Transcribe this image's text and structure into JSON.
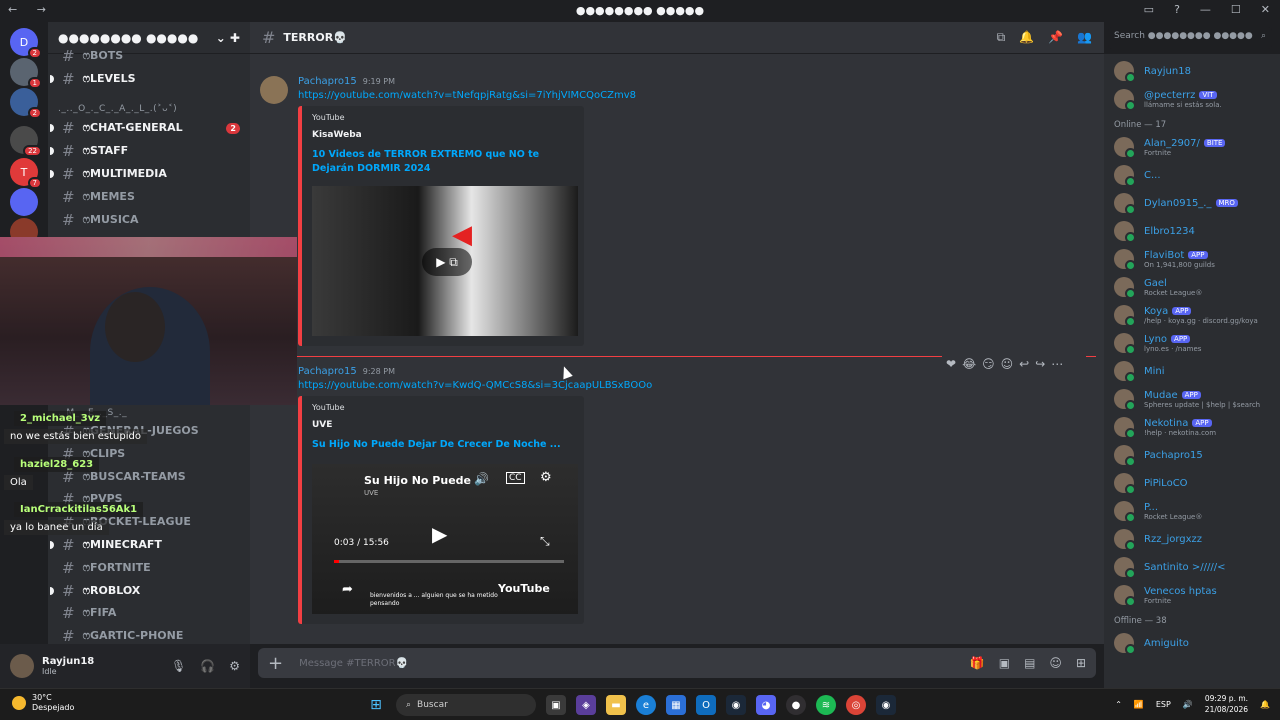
{
  "titlebar": {
    "title": "●●●●●●●● ●●●●●",
    "nav": "← →"
  },
  "servers": [
    {
      "label": "D",
      "badge": "2",
      "color": "#5865f2"
    },
    {
      "label": "",
      "badge": "1",
      "color": "#5a6470"
    },
    {
      "label": "",
      "badge": "2",
      "color": "#3a5f9a"
    },
    {
      "label": "",
      "badge": "22",
      "color": "#4a4a4a"
    },
    {
      "label": "T",
      "badge": "7",
      "color": "#e03a3a"
    },
    {
      "label": "",
      "badge": "",
      "color": "#5865f2"
    },
    {
      "label": "",
      "badge": "",
      "color": "#8a3a2a"
    }
  ],
  "guild": {
    "name": "●●●●●●●● ●●●●●"
  },
  "channels": {
    "top": [
      {
        "name": "ෆBOTS",
        "unread": false,
        "badge": ""
      },
      {
        "name": "ෆLEVELS",
        "unread": true,
        "badge": ""
      }
    ],
    "category1": "._.._O_._C_._A_._L_.(˃ᴗ˂)",
    "list": [
      {
        "name": "ෆCHAT-GENERAL",
        "unread": true,
        "badge": "2"
      },
      {
        "name": "ෆSTAFF",
        "unread": true,
        "badge": ""
      },
      {
        "name": "ෆMULTIMEDIA",
        "unread": true,
        "badge": ""
      },
      {
        "name": "ෆMEMES",
        "unread": false,
        "badge": ""
      },
      {
        "name": "ෆMUSICA",
        "unread": false,
        "badge": ""
      }
    ],
    "category2": "._M_._E_._S_._",
    "list2": [
      {
        "name": "ෆGENERAL-JUEGOS",
        "unread": false,
        "badge": ""
      },
      {
        "name": "ෆCLIPS",
        "unread": false,
        "badge": ""
      },
      {
        "name": "ෆBUSCAR-TEAMS",
        "unread": false,
        "badge": ""
      },
      {
        "name": "ෆPVPS",
        "unread": false,
        "badge": ""
      },
      {
        "name": "ෆROCKET-LEAGUE",
        "unread": false,
        "badge": ""
      },
      {
        "name": "ෆMINECRAFT",
        "unread": true,
        "badge": ""
      },
      {
        "name": "ෆFORTNITE",
        "unread": false,
        "badge": ""
      },
      {
        "name": "ෆROBLOX",
        "unread": true,
        "badge": ""
      },
      {
        "name": "ෆFIFA",
        "unread": false,
        "badge": ""
      },
      {
        "name": "ෆGARTIC-PHONE",
        "unread": false,
        "badge": ""
      }
    ]
  },
  "user": {
    "name": "Rayjun18",
    "status": "Idle"
  },
  "chat": {
    "channel": "TERROR💀",
    "search_placeholder": "Search ●●●●●●●● ●●●●●",
    "composer_placeholder": "Message #TERROR💀",
    "messages": [
      {
        "author": "Pachapro15",
        "time": "9:19 PM",
        "link": "https://youtube.com/watch?v=tNefqpjRatg&si=7iYhjVIMCQoCZmv8",
        "embed": {
          "provider": "YouTube",
          "author": "KisaWeba",
          "title": "10 Videos de TERROR EXTREMO que NO te Dejarán DORMIR 2024"
        }
      },
      {
        "author": "Pachapro15",
        "time": "9:28 PM",
        "link": "https://youtube.com/watch?v=KwdQ-QMCcS8&si=3CjcaapULBSxBOOo",
        "embed": {
          "provider": "YouTube",
          "author": "UVE",
          "title": "Su Hijo No Puede Dejar De Crecer De Noche ...",
          "player_title": "Su Hijo No Puede",
          "player_channel": "UVE",
          "time": "0:03 / 15:56",
          "caption": "bienvenidos a ... alguien que se ha metido pensando",
          "logo": "YouTube"
        }
      }
    ]
  },
  "members": {
    "top": [
      {
        "name": "Rayjun18",
        "sub": "",
        "tag": "",
        "color": "#3ba0e6"
      },
      {
        "name": "@pecterrz",
        "sub": "llámame si estás sola.",
        "tag": "VIT",
        "color": "#3ba0e6"
      }
    ],
    "online_label": "Online — 17",
    "online": [
      {
        "name": "Alan_2907/",
        "sub": "Fortnite",
        "tag": "BITE"
      },
      {
        "name": "C...",
        "sub": "",
        "tag": ""
      },
      {
        "name": "Dylan0915_._",
        "sub": "",
        "tag": "MRO"
      },
      {
        "name": "Elbro1234",
        "sub": "",
        "tag": ""
      },
      {
        "name": "FlaviBot",
        "sub": "On 1,941,800 guilds",
        "tag": "APP"
      },
      {
        "name": "Gael",
        "sub": "Rocket League®",
        "tag": ""
      },
      {
        "name": "Koya",
        "sub": "/help · koya.gg · discord.gg/koya",
        "tag": "APP"
      },
      {
        "name": "Lyno",
        "sub": "lyno.es · /names",
        "tag": "APP"
      },
      {
        "name": "Mini",
        "sub": "",
        "tag": ""
      },
      {
        "name": "Mudae",
        "sub": "Spheres update | $help | $search",
        "tag": "APP"
      },
      {
        "name": "Nekotina",
        "sub": "!help · nekotina.com",
        "tag": "APP"
      },
      {
        "name": "Pachapro15",
        "sub": "",
        "tag": ""
      },
      {
        "name": "PiPiLoCO",
        "sub": "",
        "tag": ""
      },
      {
        "name": "P...",
        "sub": "Rocket League®",
        "tag": ""
      },
      {
        "name": "Rzz_jorgxzz",
        "sub": "",
        "tag": ""
      },
      {
        "name": "Santinito >/////<",
        "sub": "",
        "tag": ""
      },
      {
        "name": "Venecos hptas",
        "sub": "Fortnite",
        "tag": ""
      }
    ],
    "offline_label": "Offline — 38",
    "offline": [
      {
        "name": "Amiguito",
        "sub": "",
        "tag": ""
      }
    ]
  },
  "overlay": {
    "chat": [
      {
        "name": "2_michael_3vz",
        "text": "no we estás bien estupido"
      },
      {
        "name": "haziel28_623",
        "text": "Ola"
      },
      {
        "name": "IanCrrackitilas56Ak1",
        "text": "ya lo banee un día"
      }
    ]
  },
  "taskbar": {
    "temp": "30°C",
    "weather": "Despejado",
    "search": "Buscar",
    "lang": "ESP",
    "time": "09:29 p. m.",
    "date": "21/08/2026"
  },
  "colors": {
    "accent": "#5865f2",
    "link": "#00a8fc",
    "new": "#f23f43",
    "online": "#23a55a"
  }
}
